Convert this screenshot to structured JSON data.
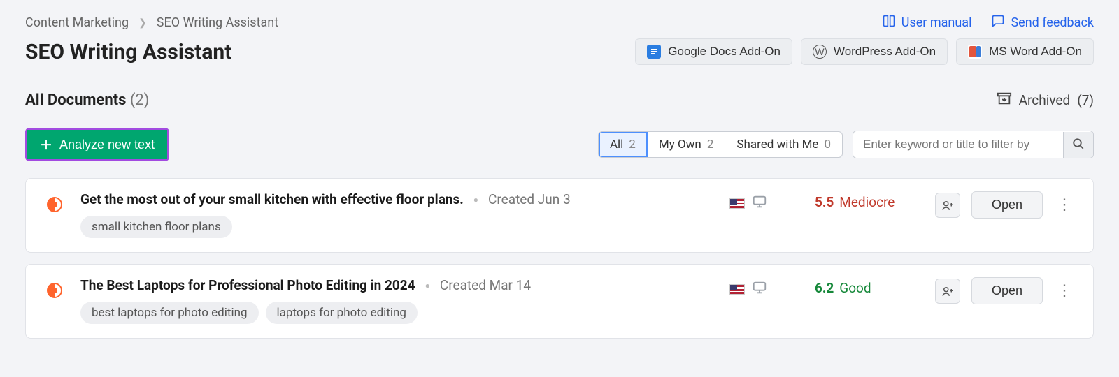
{
  "breadcrumb": {
    "parent": "Content Marketing",
    "current": "SEO Writing Assistant"
  },
  "top_links": {
    "manual": "User manual",
    "feedback": "Send feedback"
  },
  "page_title": "SEO Writing Assistant",
  "addons": {
    "gdocs": "Google Docs Add-On",
    "wp": "WordPress Add-On",
    "msword": "MS Word Add-On"
  },
  "docs_header": {
    "title": "All Documents",
    "count": "(2)",
    "archived_label": "Archived",
    "archived_count": "(7)"
  },
  "analyze_label": "Analyze new text",
  "tabs": [
    {
      "label": "All",
      "count": "2",
      "active": true
    },
    {
      "label": "My Own",
      "count": "2",
      "active": false
    },
    {
      "label": "Shared with Me",
      "count": "0",
      "active": false
    }
  ],
  "filter_placeholder": "Enter keyword or title to filter by",
  "open_label": "Open",
  "documents": [
    {
      "title": "Get the most out of your small kitchen with effective floor plans.",
      "created": "Created Jun 3",
      "tags": [
        "small kitchen floor plans"
      ],
      "score_val": "5.5",
      "score_label": "Mediocre",
      "score_class": "score-mediocre"
    },
    {
      "title": "The Best Laptops for Professional Photo Editing in 2024",
      "created": "Created Mar 14",
      "tags": [
        "best laptops for photo editing",
        "laptops for photo editing"
      ],
      "score_val": "6.2",
      "score_label": "Good",
      "score_class": "score-good"
    }
  ]
}
